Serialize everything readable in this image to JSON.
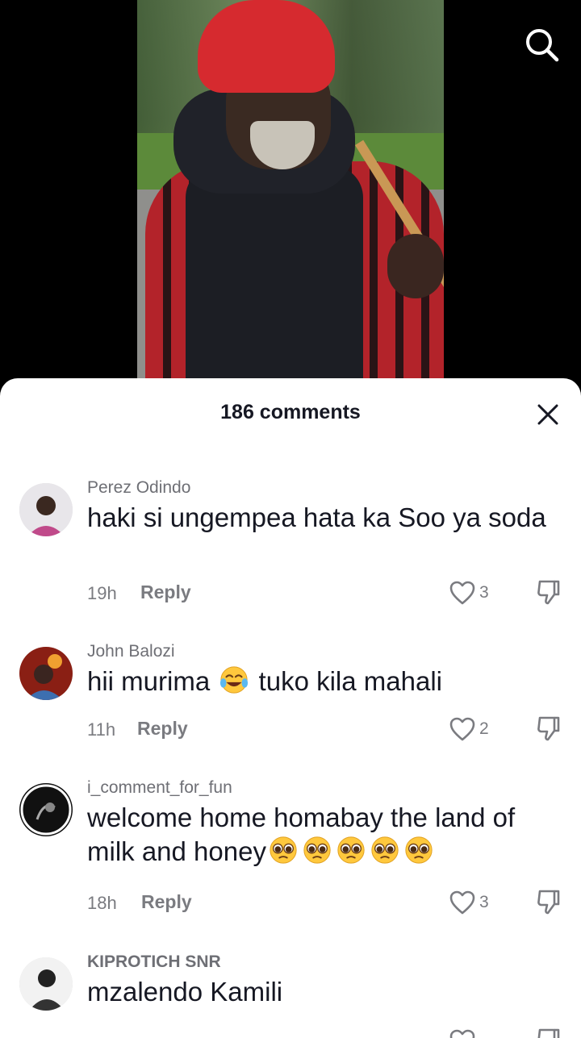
{
  "comments_sheet": {
    "count_label": "186 comments"
  },
  "comments": [
    {
      "username": "Perez Odindo",
      "text": "haki si ungempea hata ka Soo ya soda",
      "time": "19h",
      "reply_label": "Reply",
      "likes": "3"
    },
    {
      "username": "John Balozi",
      "text_before": "hii murima",
      "text_after": "tuko kila mahali",
      "emoji": "face-with-tears-of-joy",
      "time": "11h",
      "reply_label": "Reply",
      "likes": "2"
    },
    {
      "username": "i_comment_for_fun",
      "text": "welcome home homabay the land of milk and honey",
      "emoji": "pleading-face",
      "emoji_count": 5,
      "time": "18h",
      "reply_label": "Reply",
      "likes": "3"
    },
    {
      "username": "KIPROTICH SNR",
      "text": "mzalendo Kamili"
    }
  ],
  "icons": {
    "search": "search-icon",
    "close": "close-icon",
    "like": "heart-outline-icon",
    "dislike": "thumbs-down-icon"
  },
  "colors": {
    "text_primary": "#161823",
    "text_secondary": "#7a7b80",
    "sheet_bg": "#ffffff",
    "background": "#000000"
  }
}
